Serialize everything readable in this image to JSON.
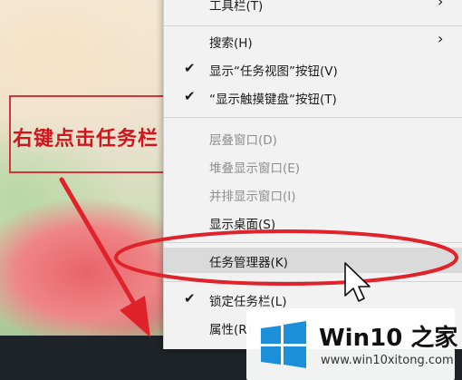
{
  "annotation": {
    "text": "右键点击任务栏"
  },
  "context_menu": {
    "items": [
      {
        "label": "工具栏(T)",
        "checked": false,
        "submenu": true,
        "disabled": false
      },
      {
        "label": "搜索(H)",
        "checked": false,
        "submenu": true,
        "disabled": false
      },
      {
        "label": "显示“任务视图”按钮(V)",
        "checked": true,
        "submenu": false,
        "disabled": false
      },
      {
        "label": "“显示触摸键盘“按钮(T)",
        "checked": true,
        "submenu": false,
        "disabled": false
      },
      {
        "label": "层叠窗口(D)",
        "checked": false,
        "submenu": false,
        "disabled": true
      },
      {
        "label": "堆叠显示窗口(E)",
        "checked": false,
        "submenu": false,
        "disabled": true
      },
      {
        "label": "并排显示窗口(I)",
        "checked": false,
        "submenu": false,
        "disabled": true
      },
      {
        "label": "显示桌面(S)",
        "checked": false,
        "submenu": false,
        "disabled": false
      },
      {
        "label": "任务管理器(K)",
        "checked": false,
        "submenu": false,
        "disabled": false,
        "highlighted": true
      },
      {
        "label": "锁定任务栏(L)",
        "checked": true,
        "submenu": false,
        "disabled": false
      },
      {
        "label": "属性(R)",
        "checked": false,
        "submenu": false,
        "disabled": false
      }
    ],
    "check_glyph": "✔",
    "submenu_glyph": "›"
  },
  "watermark": {
    "title": "Win10 之家",
    "url": "www.win10xitong.com",
    "logo_color": "#1b8fd9"
  },
  "colors": {
    "annotation_red": "#d3141c",
    "taskbar": "#1d2326",
    "menu_bg": "#f2f2f2"
  }
}
